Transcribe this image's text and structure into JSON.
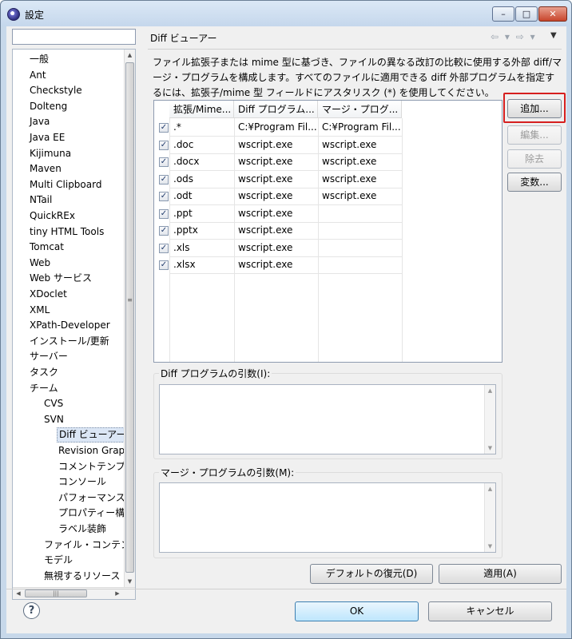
{
  "window": {
    "title": "設定"
  },
  "window_buttons": {
    "minimize": "–",
    "maximize": "□",
    "close": "✕"
  },
  "filter": {
    "value": "",
    "placeholder": ""
  },
  "tree_items": [
    "一般",
    "Ant",
    "Checkstyle",
    "Dolteng",
    "Java",
    "Java EE",
    "Kijimuna",
    "Maven",
    "Multi Clipboard",
    "NTail",
    "QuickREx",
    "tiny HTML Tools",
    "Tomcat",
    "Web",
    "Web サービス",
    "XDoclet",
    "XML",
    "XPath-Developer",
    "インストール/更新",
    "サーバー",
    "タスク",
    "チーム",
    "CVS",
    "SVN",
    "Diff ビューアー",
    "Revision Graph",
    "コメントテンプ|",
    "コンソール",
    "パフォーマンス",
    "プロパティー構/",
    "ラベル装飾",
    "ファイル・コンテン",
    "モデル",
    "無視するリソース"
  ],
  "tree_selected": "Diff ビューアー",
  "page": {
    "title": "Diff ビューアー",
    "description": "ファイル拡張子または mime 型に基づき、ファイルの異なる改訂の比較に使用する外部 diff/マージ・プログラムを構成します。すべてのファイルに適用できる diff 外部プログラムを指定するには、拡張子/mime 型 フィールドにアスタリスク (*) を使用してください。"
  },
  "table": {
    "headers": [
      "拡張/Mime...",
      "Diff プログラム...",
      "マージ・プログ..."
    ],
    "rows": [
      {
        "ext": ".*",
        "diff": "C:¥Program Fil...",
        "merge": "C:¥Program Fil...",
        "checked": true
      },
      {
        "ext": ".doc",
        "diff": "wscript.exe",
        "merge": "wscript.exe",
        "checked": true
      },
      {
        "ext": ".docx",
        "diff": "wscript.exe",
        "merge": "wscript.exe",
        "checked": true
      },
      {
        "ext": ".ods",
        "diff": "wscript.exe",
        "merge": "wscript.exe",
        "checked": true
      },
      {
        "ext": ".odt",
        "diff": "wscript.exe",
        "merge": "wscript.exe",
        "checked": true
      },
      {
        "ext": ".ppt",
        "diff": "wscript.exe",
        "merge": "",
        "checked": true
      },
      {
        "ext": ".pptx",
        "diff": "wscript.exe",
        "merge": "",
        "checked": true
      },
      {
        "ext": ".xls",
        "diff": "wscript.exe",
        "merge": "",
        "checked": true
      },
      {
        "ext": ".xlsx",
        "diff": "wscript.exe",
        "merge": "",
        "checked": true
      }
    ]
  },
  "buttons": {
    "add": "追加...",
    "edit": "編集...",
    "remove": "除去",
    "variables": "変数...",
    "restore_defaults": "デフォルトの復元(D)",
    "apply": "適用(A)",
    "ok": "OK",
    "cancel": "キャンセル"
  },
  "groups": {
    "diff_args": "Diff プログラムの引数(I):",
    "merge_args": "マージ・プログラムの引数(M):"
  },
  "check_glyph": "✓",
  "colors": {
    "highlight": "#d61f1f",
    "selection": "#dbe6f5"
  }
}
